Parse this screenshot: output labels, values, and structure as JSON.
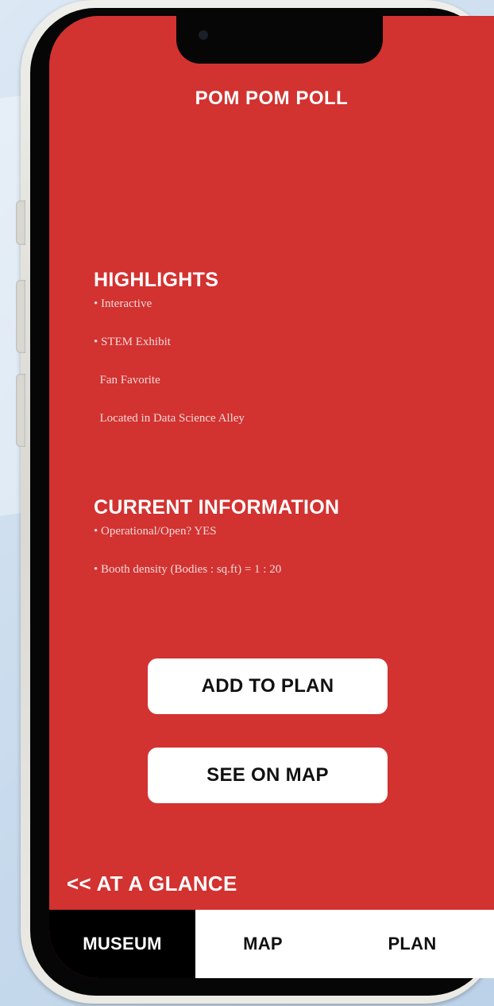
{
  "screen": {
    "title": "POM POM POLL"
  },
  "highlights": {
    "heading": "HIGHLIGHTS",
    "items": [
      "• Interactive",
      "• STEM Exhibit",
      "  Fan Favorite",
      "  Located in Data Science Alley"
    ]
  },
  "current_information": {
    "heading": "CURRENT INFORMATION",
    "items": [
      "• Operational/Open? YES",
      "• Booth density (Bodies : sq.ft) = 1 : 20"
    ]
  },
  "actions": {
    "add_to_plan": "ADD TO PLAN",
    "see_on_map": "SEE ON MAP"
  },
  "navigation": {
    "back_label": "<< AT A GLANCE",
    "tabs": [
      {
        "label": "MUSEUM",
        "active": true
      },
      {
        "label": "MAP",
        "active": false
      },
      {
        "label": "PLAN",
        "active": false
      }
    ]
  },
  "colors": {
    "screen_background": "#d23230",
    "active_tab": "#000000",
    "button": "#ffffff"
  }
}
